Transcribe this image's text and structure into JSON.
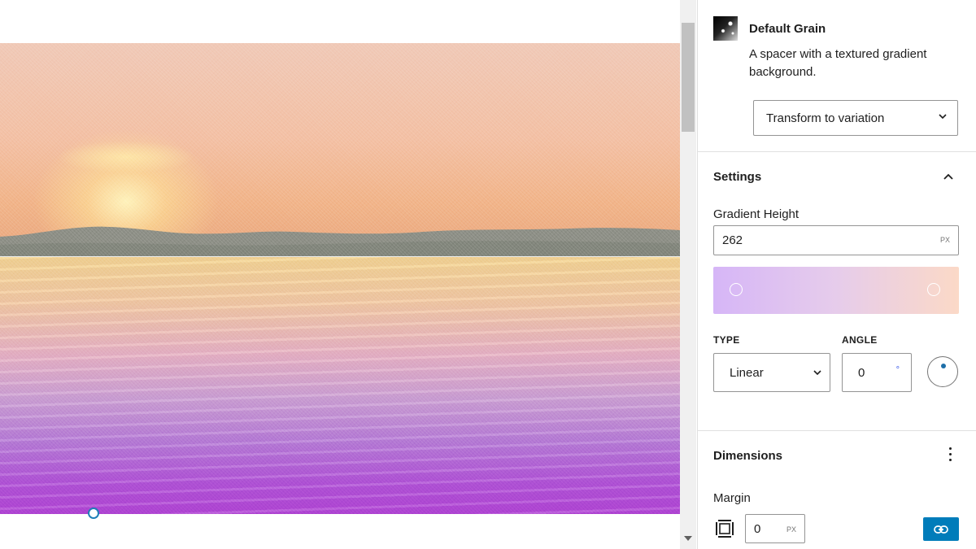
{
  "block": {
    "icon": "grain-texture-icon",
    "title": "Default Grain",
    "description": "A spacer with a textured gradient background.",
    "variation_select": "Transform to variation"
  },
  "settings": {
    "title": "Settings",
    "gradient_height_label": "Gradient Height",
    "gradient_height_value": "262",
    "gradient_height_unit": "PX",
    "gradient": {
      "stop_colors": [
        "#d6b6f7",
        "#fbd9c7"
      ]
    },
    "type_label": "TYPE",
    "type_value": "Linear",
    "angle_label": "ANGLE",
    "angle_value": "0",
    "angle_unit": "°"
  },
  "dimensions": {
    "title": "Dimensions",
    "margin_label": "Margin",
    "margin_value": "0",
    "margin_unit": "PX"
  },
  "colors": {
    "accent": "#007cba",
    "border": "#949494"
  }
}
